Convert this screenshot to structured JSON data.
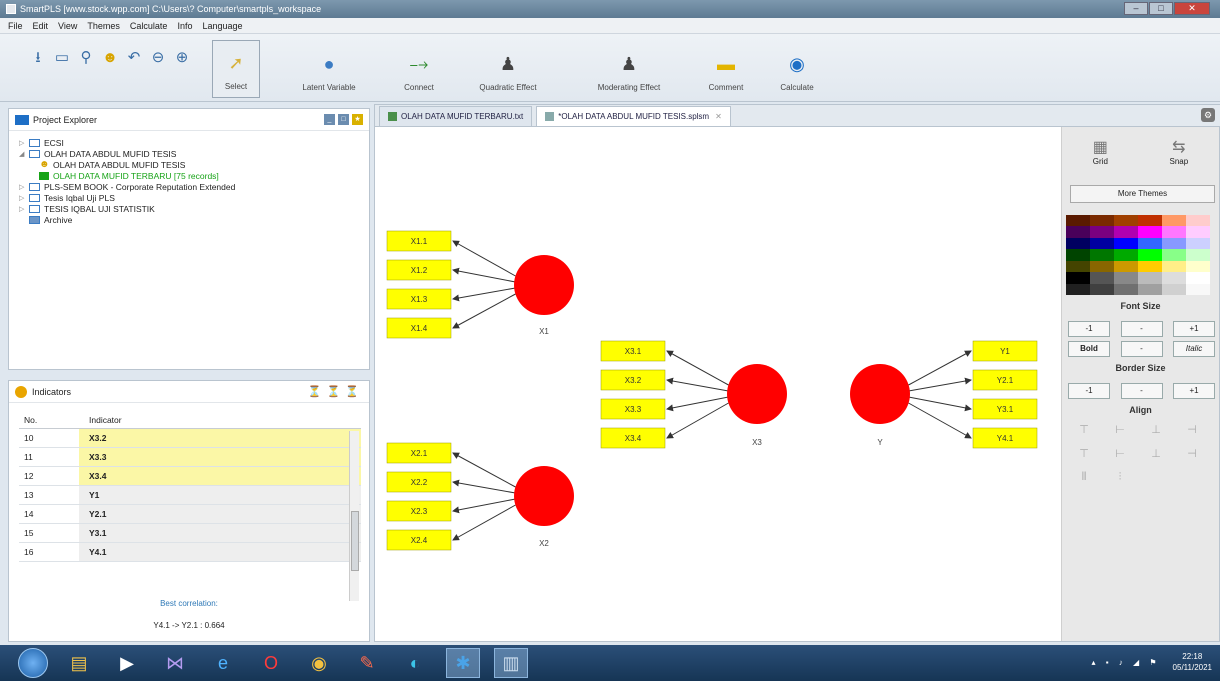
{
  "window": {
    "title": "SmartPLS [www.stock.wpp.com] C:\\Users\\? Computer\\smartpls_workspace"
  },
  "menu": [
    "File",
    "Edit",
    "View",
    "Themes",
    "Calculate",
    "Info",
    "Language"
  ],
  "toolbar": {
    "small_icons": [
      "save-icon",
      "new-project-icon",
      "import-data-icon",
      "user-icon",
      "undo-icon",
      "zoom-out-icon",
      "zoom-in-icon"
    ],
    "tools": [
      {
        "label": "Select",
        "icon": "cursor-icon"
      },
      {
        "label": "Latent Variable",
        "icon": "latent-variable-icon"
      },
      {
        "label": "Connect",
        "icon": "connect-icon"
      },
      {
        "label": "Quadratic Effect",
        "icon": "quadratic-effect-icon"
      },
      {
        "label": "Moderating Effect",
        "icon": "moderating-effect-icon"
      },
      {
        "label": "Comment",
        "icon": "comment-icon"
      },
      {
        "label": "Calculate",
        "icon": "calculate-icon"
      }
    ]
  },
  "project_explorer": {
    "title": "Project Explorer",
    "items": [
      {
        "label": "ECSI",
        "level": 0,
        "expanded": false
      },
      {
        "label": "OLAH DATA ABDUL MUFID TESIS",
        "level": 0,
        "expanded": true
      },
      {
        "label": "OLAH DATA ABDUL MUFID TESIS",
        "level": 1,
        "kind": "model"
      },
      {
        "label": "OLAH DATA MUFID TERBARU [75 records]",
        "level": 1,
        "kind": "data"
      },
      {
        "label": "PLS-SEM BOOK - Corporate Reputation Extended",
        "level": 0,
        "expanded": false
      },
      {
        "label": "Tesis Iqbal Uji PLS",
        "level": 0,
        "expanded": false
      },
      {
        "label": "TESIS IQBAL UJI STATISTIK",
        "level": 0,
        "expanded": false
      },
      {
        "label": "Archive",
        "level": 0,
        "kind": "archive"
      }
    ]
  },
  "indicators": {
    "title": "Indicators",
    "columns": [
      "No.",
      "Indicator"
    ],
    "rows": [
      {
        "no": "10",
        "indicator": "X3.2",
        "highlight": true
      },
      {
        "no": "11",
        "indicator": "X3.3",
        "highlight": true
      },
      {
        "no": "12",
        "indicator": "X3.4",
        "highlight": true
      },
      {
        "no": "13",
        "indicator": "Y1",
        "highlight": false
      },
      {
        "no": "14",
        "indicator": "Y2.1",
        "highlight": false
      },
      {
        "no": "15",
        "indicator": "Y3.1",
        "highlight": false
      },
      {
        "no": "16",
        "indicator": "Y4.1",
        "highlight": false
      }
    ],
    "best_correlation_label": "Best correlation:",
    "best_correlation_value": "Y4.1 -> Y2.1 : 0.664"
  },
  "editor": {
    "tabs": [
      {
        "label": "OLAH DATA MUFID TERBARU.txt",
        "active": false
      },
      {
        "label": "*OLAH DATA ABDUL MUFID TESIS.splsm",
        "active": true
      }
    ]
  },
  "model": {
    "constructs": [
      "X1",
      "X2",
      "X3",
      "Y"
    ],
    "indicators": {
      "X1": [
        "X1.1",
        "X1.2",
        "X1.3",
        "X1.4"
      ],
      "X2": [
        "X2.1",
        "X2.2",
        "X2.3",
        "X2.4"
      ],
      "X3": [
        "X3.1",
        "X3.2",
        "X3.3",
        "X3.4"
      ],
      "Y": [
        "Y1",
        "Y2.1",
        "Y3.1",
        "Y4.1"
      ]
    },
    "construct_color": "#ff0000",
    "indicator_color": "#ffff00"
  },
  "side_panel": {
    "grid_label": "Grid",
    "snap_label": "Snap",
    "more_themes": "More Themes",
    "font_size_title": "Font Size",
    "font_buttons": [
      "-1",
      "-",
      "+1"
    ],
    "style_buttons": [
      "Bold",
      "-",
      "Italic"
    ],
    "border_size_title": "Border Size",
    "border_buttons": [
      "-1",
      "-",
      "+1"
    ],
    "align_title": "Align",
    "palette": [
      "#5a1a00",
      "#7a2a00",
      "#a04000",
      "#c03000",
      "#ff9966",
      "#ffcccc",
      "#4a005a",
      "#7a0080",
      "#b000b0",
      "#ff00ff",
      "#ff77ff",
      "#ffccff",
      "#000060",
      "#0000a0",
      "#0000ff",
      "#3366ff",
      "#8899ff",
      "#ccd0ff",
      "#004400",
      "#007700",
      "#00aa00",
      "#00ff00",
      "#88ff88",
      "#ccffcc",
      "#444400",
      "#886600",
      "#cc9900",
      "#ffcc00",
      "#ffee88",
      "#ffffcc",
      "#000000",
      "#555555",
      "#888888",
      "#bbbbbb",
      "#dddddd",
      "#ffffff",
      "#202020",
      "#404040",
      "#707070",
      "#a0a0a0",
      "#d0d0d0",
      "#f8f8f8"
    ]
  },
  "taskbar": {
    "time": "22:18",
    "date": "05/11/2021",
    "apps": [
      "file-explorer-icon",
      "media-player-icon",
      "vs-icon",
      "ie-icon",
      "opera-icon",
      "chrome-icon",
      "paint-icon",
      "edge-icon",
      "smartpls-icon",
      "notepad-icon"
    ]
  }
}
